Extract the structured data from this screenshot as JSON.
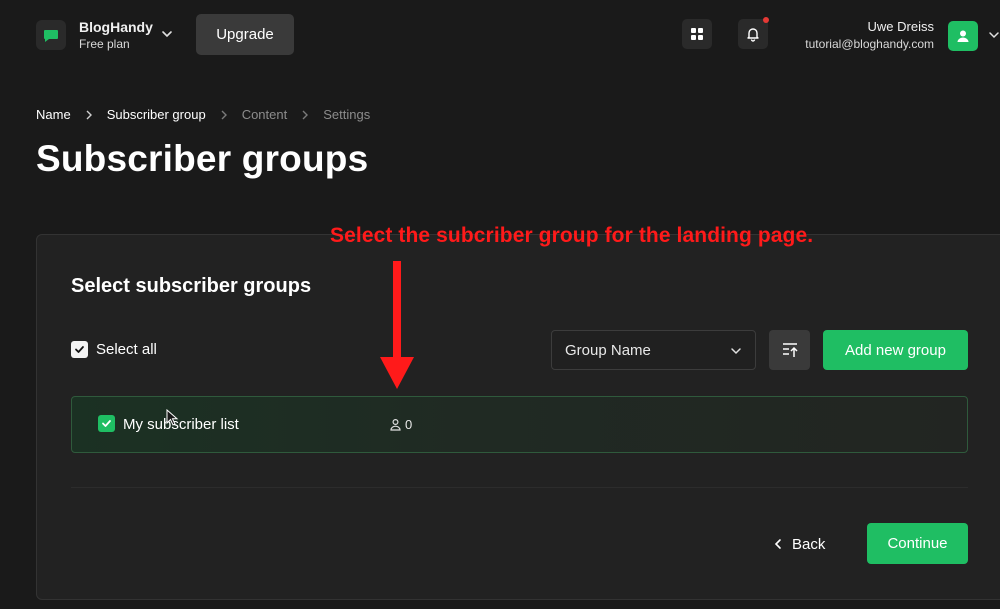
{
  "workspace": {
    "name": "BlogHandy",
    "plan": "Free plan",
    "logo_icon": "chat-bubble-icon",
    "upgrade_label": "Upgrade"
  },
  "header_icons": {
    "apps": "grid-icon",
    "notifications": "bell-icon",
    "notification_dot_color": "#e53935"
  },
  "user": {
    "name": "Uwe Dreiss",
    "email": "tutorial@bloghandy.com",
    "avatar_icon": "user-icon"
  },
  "breadcrumb": [
    {
      "label": "Name",
      "active": true
    },
    {
      "label": "Subscriber group",
      "active": true
    },
    {
      "label": "Content",
      "active": false
    },
    {
      "label": "Settings",
      "active": false
    }
  ],
  "page": {
    "title": "Subscriber groups"
  },
  "card": {
    "title": "Select subscriber groups",
    "select_all_label": "Select all",
    "select_all_checked": true,
    "sort_select": {
      "selected": "Group Name"
    },
    "add_group_label": "Add new group",
    "groups": [
      {
        "name": "My subscriber list",
        "subscribers": "0",
        "checked": true
      }
    ],
    "back_label": "Back",
    "continue_label": "Continue"
  },
  "annotation": {
    "text": "Select the subcriber group for the landing page.",
    "color": "#ff1a1a"
  },
  "colors": {
    "accent": "#1fbe63",
    "background": "#1a1a1a",
    "card": "#222222"
  }
}
